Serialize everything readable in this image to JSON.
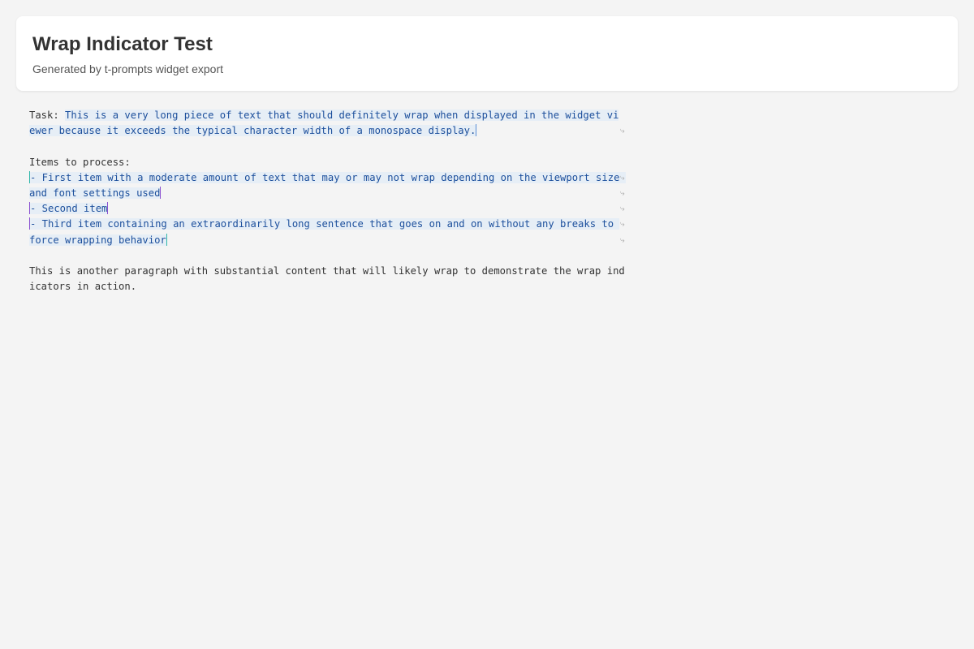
{
  "header": {
    "title": "Wrap Indicator Test",
    "subtitle": "Generated by t-prompts widget export"
  },
  "content": {
    "task_label": "Task: ",
    "task_line_1": "This is a very long piece of text that should definitely wrap when displayed in the widget vi",
    "task_line_2": "ewer because it exceeds the typical character width of a monospace display.",
    "items_heading": "Items to process:",
    "item1_line_1": "- First item with a moderate amount of text that may or may not wrap depending on the viewport size ",
    "item1_line_2": "and font settings used",
    "item2_line_1": "- Second item",
    "item3_line_1": "- Third item containing an extraordinarily long sentence that goes on and on without any breaks to ",
    "item3_line_2": "force wrapping behavior",
    "para_line_1": "This is another paragraph with substantial content that will likely wrap to demonstrate the wrap ind",
    "para_line_2": "icators in action.",
    "wrap_glyph": "⤷"
  },
  "colors": {
    "background": "#f4f4f4",
    "card": "#ffffff",
    "interpolation_bg": "#e6eef6",
    "interpolation_text": "#1c4f9c",
    "cursor_blue": "#5a8fd6",
    "cursor_teal": "#2fb6a9",
    "cursor_purple": "#8a4fd0"
  }
}
